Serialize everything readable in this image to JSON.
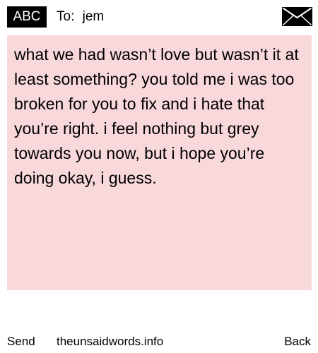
{
  "header": {
    "input_mode": "ABC",
    "to_label": "To:",
    "recipient": "jem",
    "envelope_icon": "envelope-icon"
  },
  "message": {
    "text": "what we had wasn’t love but wasn’t it at least something? you told me i was too broken for you to fix and i hate that you’re right. i feel nothing but grey towards you now, but i hope you’re doing okay, i guess.",
    "background": "#f9d8dc"
  },
  "footer": {
    "send_label": "Send",
    "site_label": "theunsaidwords.info",
    "back_label": "Back"
  }
}
